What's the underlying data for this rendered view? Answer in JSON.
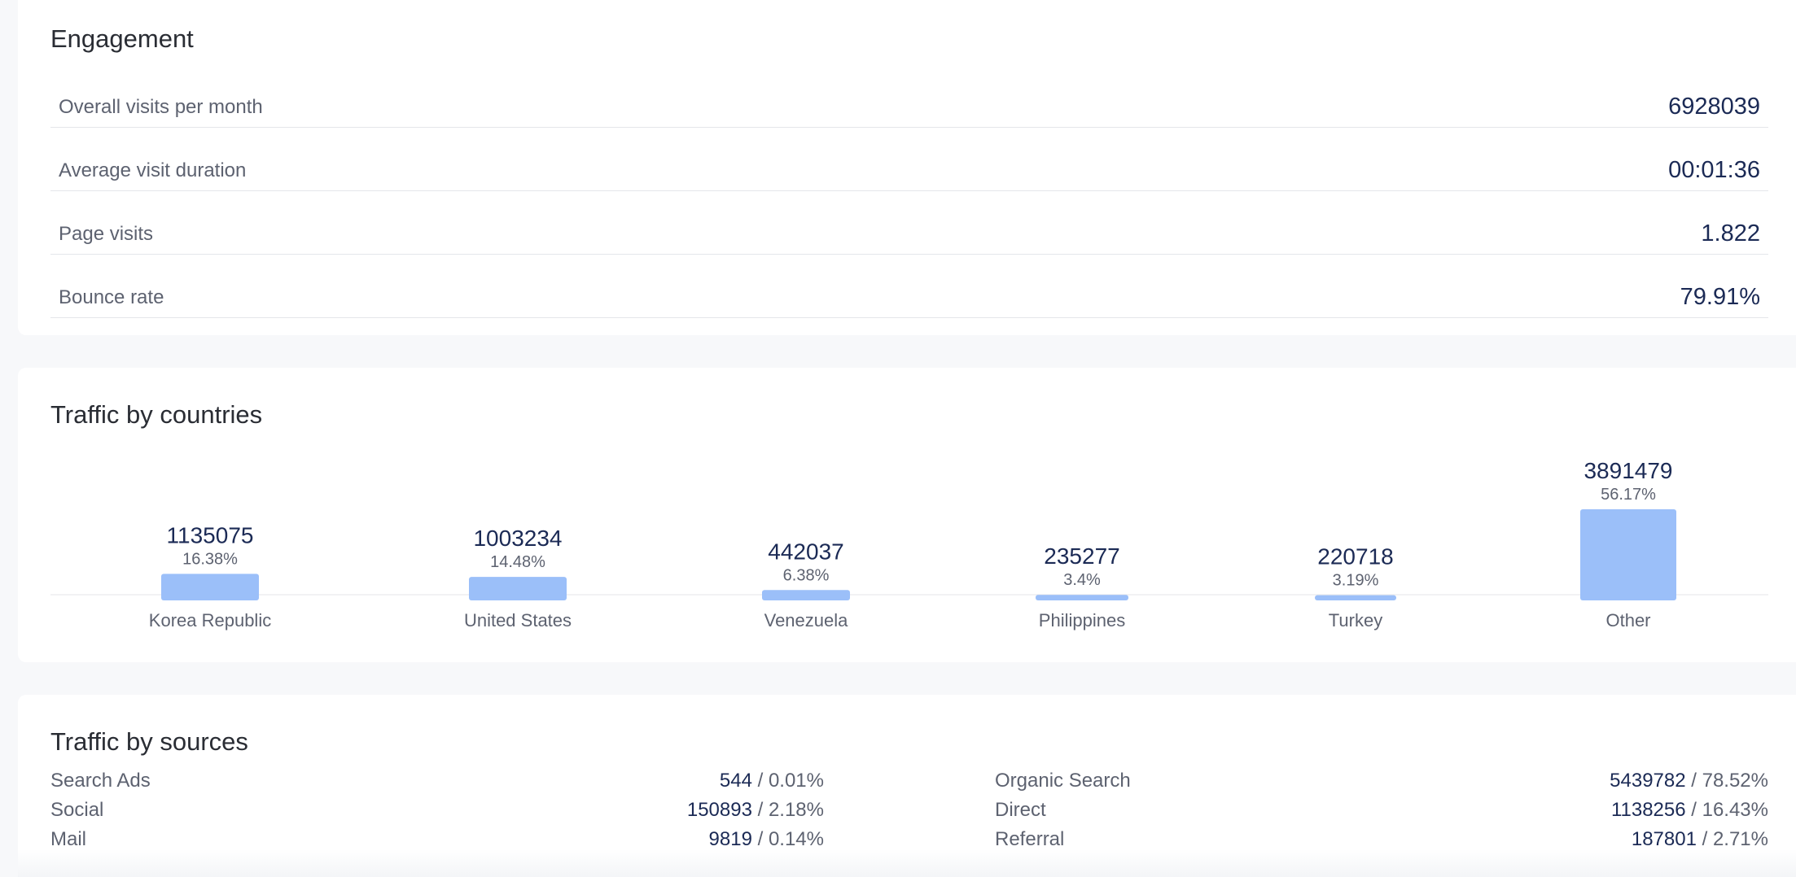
{
  "engagement": {
    "title": "Engagement",
    "rows": [
      {
        "label": "Overall visits per month",
        "value": "6928039"
      },
      {
        "label": "Average visit duration",
        "value": "00:01:36"
      },
      {
        "label": "Page visits",
        "value": "1.822"
      },
      {
        "label": "Bounce rate",
        "value": "79.91%"
      }
    ]
  },
  "countries": {
    "title": "Traffic by countries"
  },
  "chart_data": {
    "type": "bar",
    "title": "Traffic by countries",
    "categories": [
      "Korea Republic",
      "United States",
      "Venezuela",
      "Philippines",
      "Turkey",
      "Other"
    ],
    "values": [
      1135075,
      1003234,
      442037,
      235277,
      220718,
      3891479
    ],
    "percent_labels": [
      "16.38%",
      "14.48%",
      "6.38%",
      "3.4%",
      "3.19%",
      "56.17%"
    ],
    "grid": false,
    "bar_color": "#9bbff9"
  },
  "sources": {
    "title": "Traffic by sources",
    "left": [
      {
        "label": "Search Ads",
        "value": "544",
        "percent": " / 0.01%"
      },
      {
        "label": "Social",
        "value": "150893",
        "percent": " / 2.18%"
      },
      {
        "label": "Mail",
        "value": "9819",
        "percent": " / 0.14%"
      }
    ],
    "right": [
      {
        "label": "Organic Search",
        "value": "5439782",
        "percent": " / 78.52%"
      },
      {
        "label": "Direct",
        "value": "1138256",
        "percent": " / 16.43%"
      },
      {
        "label": "Referral",
        "value": "187801",
        "percent": " / 2.71%"
      }
    ]
  },
  "colors": {
    "value_text": "#1b2a55",
    "label_text": "#5d6270",
    "bar": "#9bbff9"
  }
}
